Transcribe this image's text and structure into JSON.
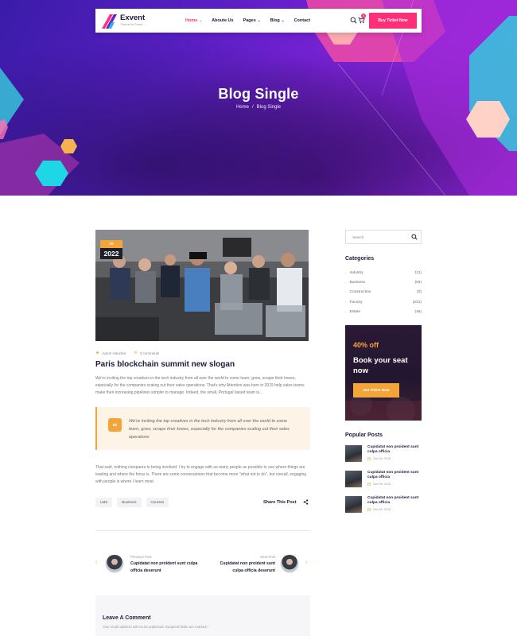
{
  "brand": {
    "name": "Exvent",
    "tagline": "Theme for Event"
  },
  "nav": {
    "items": [
      {
        "label": "Home",
        "active": true,
        "dropdown": true
      },
      {
        "label": "Aboute Us",
        "active": false,
        "dropdown": false
      },
      {
        "label": "Pages",
        "active": false,
        "dropdown": true
      },
      {
        "label": "Blog",
        "active": false,
        "dropdown": true
      },
      {
        "label": "Contact",
        "active": false,
        "dropdown": false
      }
    ],
    "cart_count": "0",
    "cta_label": "Buy Ticket Now"
  },
  "hero": {
    "title": "Blog Single",
    "breadcrumb": [
      "Home",
      "/",
      "Blog Single"
    ]
  },
  "post": {
    "date_day": "20",
    "date_year": "2022",
    "author": "Aaron Hancher",
    "comments": "3 comments",
    "title": "Paris blockchain summit new slogan",
    "intro": "We're inviting the top creatives in the tech industry from all over the world to come learn, grow, scrape their knees, especially for the companies scaling out their sales operations. That's why Attentive was born in 2015 help sales teams make their increasing pipelines simpler to manage. Indeed, the small, Portugal based team is...",
    "quote": "We're inviting the top creatives in the tech industry from all over the world to come learn, grow, scrape their knees, especially for the companies scaling out their sales operations",
    "body": "That said, nothing compares to being involved. I try to engage with as many people as possible to see where things are leading and where the focus is. There are some conversations that become more \"what not to do\", but overall, engaging with people is where I learn most.",
    "tags": [
      "LMS",
      "Business",
      "Courses"
    ],
    "share_label": "Share This Post"
  },
  "post_nav": {
    "prev": {
      "label": "Previous Post",
      "title": "Cupidatat non proident sunt culpa officia deserunt"
    },
    "next": {
      "label": "Next Post",
      "title": "Cupidatat non proident sunt culpa officia deserunt"
    }
  },
  "comments": {
    "title": "Leave A Comment",
    "note": "Your email address will not be published. Required fields are marked *"
  },
  "sidebar": {
    "search_placeholder": "Search",
    "categories_title": "Categories",
    "categories": [
      {
        "name": "Industry",
        "count": "(11)"
      },
      {
        "name": "Business",
        "count": "(02)"
      },
      {
        "name": "Construction",
        "count": "(0)"
      },
      {
        "name": "Factory",
        "count": "(231)"
      },
      {
        "name": "Estate",
        "count": "(45)"
      }
    ],
    "promo": {
      "discount": "40% off",
      "headline": "Book your seat now",
      "button": "Get Ticket Now"
    },
    "popular_title": "Popular Posts",
    "popular": [
      {
        "title": "Cupidatat non proident sunt culpa officia",
        "date": "Oct 09, 2021"
      },
      {
        "title": "Cupidatat non proident sunt culpa officia",
        "date": "Oct 09, 2021"
      },
      {
        "title": "Cupidatat non proident sunt culpa officia",
        "date": "Oct 09, 2021"
      }
    ]
  },
  "colors": {
    "accent_pink": "#ff2e79",
    "accent_orange": "#f4a53a",
    "dark": "#1c1c3c",
    "hero_purple": "#6a20cc"
  }
}
